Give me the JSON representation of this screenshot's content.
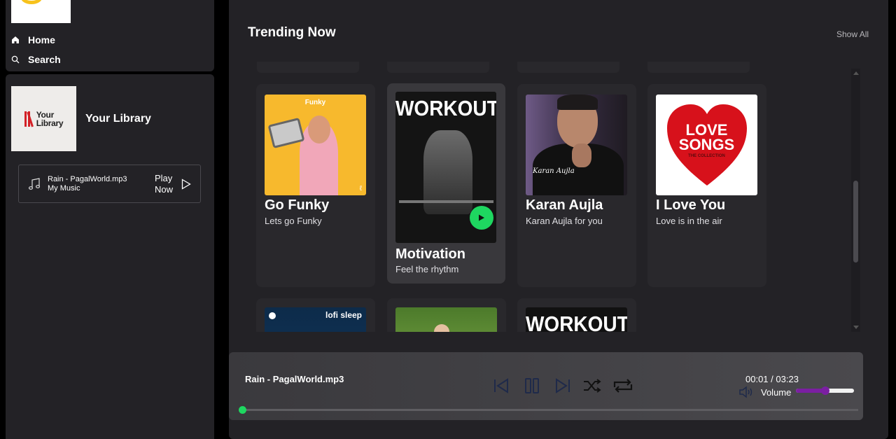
{
  "nav": {
    "home_label": "Home",
    "search_label": "Search"
  },
  "library": {
    "cover_text_line1": "Your",
    "cover_text_line2": "Library",
    "title": "Your Library",
    "recent": {
      "track": "Rain - PagalWorld.mp3",
      "source": "My Music",
      "action_line1": "Play",
      "action_line2": "Now"
    }
  },
  "main": {
    "section_title": "Trending Now",
    "show_all": "Show All",
    "cards": [
      {
        "title": "Go Funky",
        "subtitle": "Lets go Funky",
        "art_label": "Funky"
      },
      {
        "title": "Motivation",
        "subtitle": "Feel the rhythm",
        "art_label": "WORKOUT"
      },
      {
        "title": "Karan Aujla",
        "subtitle": "Karan Aujla for you",
        "art_label": "Karan Aujla"
      },
      {
        "title": "I Love You",
        "subtitle": "Love is in the air",
        "art_label_1": "LOVE",
        "art_label_2": "SONGS",
        "art_label_3": "THE COLLECTION"
      }
    ],
    "partial_cards": [
      {
        "art_label": "lofi sleep"
      },
      {
        "art_label": ""
      },
      {
        "art_label": "WORKOUT"
      }
    ]
  },
  "player": {
    "track": "Rain - PagalWorld.mp3",
    "current_time": "00:01",
    "separator": "/",
    "duration": "03:23",
    "volume_label": "Volume",
    "volume_level": 0.5,
    "progress": 0.0,
    "accent": "#1ed760",
    "volume_color": "#7b1fa2"
  }
}
